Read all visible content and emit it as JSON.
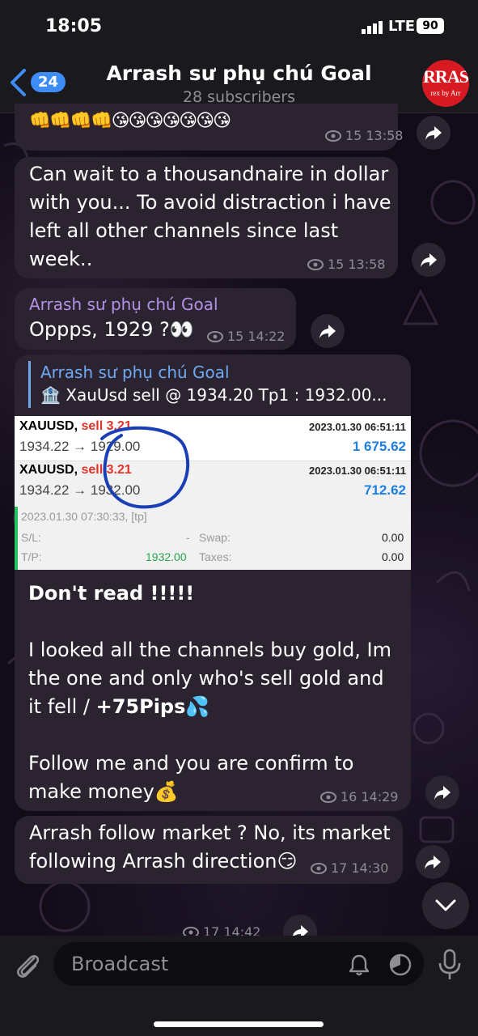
{
  "status": {
    "time": "18:05",
    "network": "LTE",
    "battery": "90"
  },
  "header": {
    "back_count": "24",
    "title": "Arrash sư phụ chú Goal",
    "subtitle": "28 subscribers",
    "avatar_text": "RRAS",
    "avatar_sub": "rex by Arr"
  },
  "messages": [
    {
      "emoji": "👊👊👊👊😘😘😘😘😘😘😘",
      "views": "15",
      "time": "13:58"
    },
    {
      "text_lines": [
        "Can wait to a thousandnaire in dollar",
        "with you... To avoid distraction i have",
        "left all other channels since last",
        "week.."
      ],
      "views": "15",
      "time": "13:58"
    },
    {
      "author": "Arrash sư phụ chú Goal",
      "text": "Oppps, 1929 ?👀",
      "views": "15",
      "time": "14:22"
    },
    {
      "reply": {
        "author": "Arrash sư phụ chú Goal",
        "text": "🏦 XauUsd sell @ 1934.20  Tp1 : 1932.00..."
      },
      "trade": {
        "row1": {
          "symbol": "XAUUSD,",
          "action": "sell 3.21",
          "date": "2023.01.30 06:51:11",
          "price": "1934.22 → 1929.00",
          "profit": "1 675.62"
        },
        "row2": {
          "symbol": "XAUUSD,",
          "action": "sell 3.21",
          "date": "2023.01.30 06:51:11",
          "price": "1934.22 → 1932.00",
          "profit": "712.62"
        },
        "close_date": "2023.01.30 07:30:33, [tp]",
        "sl_label": "S/L:",
        "sl_value": "-",
        "swap_label": "Swap:",
        "swap_value": "0.00",
        "tp_label": "T/P:",
        "tp_value": "1932.00",
        "taxes_label": "Taxes:",
        "taxes_value": "0.00"
      },
      "bold_line": "Don't read !!!!!",
      "para1_lines": [
        "I looked all the channels buy gold, Im",
        "the one and only who's sell gold and",
        "it fell / "
      ],
      "para1_bold": "+75Pips💦",
      "para2_lines": [
        "Follow me and you are confirm to",
        "make money💰"
      ],
      "views": "16",
      "time": "14:29"
    },
    {
      "text_lines": [
        "Arrash follow market ? No, its market",
        "following Arrash direction😏"
      ],
      "views": "17",
      "time": "14:30"
    },
    {
      "views": "17",
      "time": "14:42"
    }
  ],
  "input": {
    "placeholder": "Broadcast"
  }
}
